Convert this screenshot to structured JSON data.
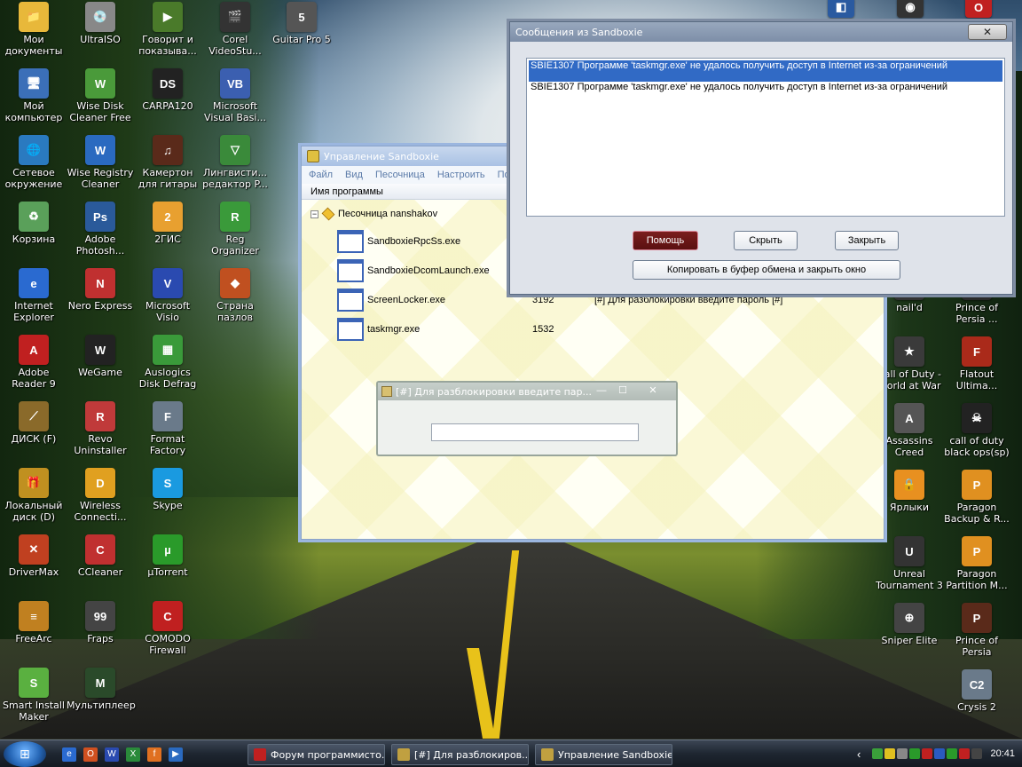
{
  "desktop": {
    "icons_left": [
      {
        "label": "Мои документы",
        "glyph": "📁",
        "color": "#e8b83a"
      },
      {
        "label": "UltraISO",
        "glyph": "💿",
        "color": "#888"
      },
      {
        "label": "Говорит и показыва...",
        "glyph": "▶",
        "color": "#4a7a2a"
      },
      {
        "label": "Corel VideoStu...",
        "glyph": "🎬",
        "color": "#333"
      },
      {
        "label": "Guitar Pro 5",
        "glyph": "5",
        "color": "#555"
      },
      {
        "label": "Мой компьютер",
        "glyph": "🖥",
        "color": "#3b6fb8"
      },
      {
        "label": "Wise Disk Cleaner Free",
        "glyph": "W",
        "color": "#4a9a3a"
      },
      {
        "label": "CARPA120",
        "glyph": "DS",
        "color": "#222"
      },
      {
        "label": "Microsoft Visual Basi...",
        "glyph": "VB",
        "color": "#3b5fb0"
      },
      {
        "label": "Сетевое окружение",
        "glyph": "🌐",
        "color": "#2a7ac0"
      },
      {
        "label": "Wise Registry Cleaner",
        "glyph": "W",
        "color": "#2a6ac0"
      },
      {
        "label": "Камертон для гитары",
        "glyph": "♫",
        "color": "#5a2a1a"
      },
      {
        "label": "Лингвисти... редактор P...",
        "glyph": "▽",
        "color": "#3a8a3a"
      },
      {
        "label": "Корзина",
        "glyph": "♻",
        "color": "#5aa05a"
      },
      {
        "label": "Adobe Photosh...",
        "glyph": "Ps",
        "color": "#2a5a9a"
      },
      {
        "label": "2ГИС",
        "glyph": "2",
        "color": "#e8a030"
      },
      {
        "label": "Reg Organizer",
        "glyph": "R",
        "color": "#3a9a3a"
      },
      {
        "label": "Internet Explorer",
        "glyph": "e",
        "color": "#2a6ad0"
      },
      {
        "label": "Nero Express",
        "glyph": "N",
        "color": "#c03030"
      },
      {
        "label": "Microsoft Visio",
        "glyph": "V",
        "color": "#2a4ab0"
      },
      {
        "label": "Страна пазлов",
        "glyph": "◆",
        "color": "#c05020"
      },
      {
        "label": "Adobe Reader 9",
        "glyph": "A",
        "color": "#c02020"
      },
      {
        "label": "WeGame",
        "glyph": "W",
        "color": "#222"
      },
      {
        "label": "Auslogics Disk Defrag",
        "glyph": "▦",
        "color": "#3a9a3a"
      },
      {
        "label": "ДИСК (F)",
        "glyph": "⟋",
        "color": "#8a6a2a"
      },
      {
        "label": "Revo Uninstaller",
        "glyph": "R",
        "color": "#c03a3a"
      },
      {
        "label": "Format Factory",
        "glyph": "F",
        "color": "#6a7a8a"
      },
      {
        "label": "Локальный диск (D)",
        "glyph": "🎁",
        "color": "#c09020"
      },
      {
        "label": "Wireless Connecti...",
        "glyph": "D",
        "color": "#e0a020"
      },
      {
        "label": "Skype",
        "glyph": "S",
        "color": "#1a9ae0"
      },
      {
        "label": "DriverMax",
        "glyph": "✕",
        "color": "#c04020"
      },
      {
        "label": "CCleaner",
        "glyph": "C",
        "color": "#c03030"
      },
      {
        "label": "µTorrent",
        "glyph": "µ",
        "color": "#2a9a2a"
      },
      {
        "label": "FreeArc",
        "glyph": "≡",
        "color": "#c08020"
      },
      {
        "label": "Fraps",
        "glyph": "99",
        "color": "#444"
      },
      {
        "label": "COMODO Firewall",
        "glyph": "C",
        "color": "#c02020"
      },
      {
        "label": "Smart Install Maker",
        "glyph": "S",
        "color": "#5ab040"
      },
      {
        "label": "Мультиплеер",
        "glyph": "M",
        "color": "#2a4a2a"
      }
    ],
    "icons_right": [
      {
        "label": "nail'd",
        "glyph": "N",
        "color": "#333"
      },
      {
        "label": "Prince of Persia ...",
        "glyph": "P",
        "color": "#2a2a2a"
      },
      {
        "label": "Call of Duty - World at War",
        "glyph": "★",
        "color": "#3a3a3a"
      },
      {
        "label": "Flatout Ultima...",
        "glyph": "F",
        "color": "#aa2a1a"
      },
      {
        "label": "Assassins Creed",
        "glyph": "A",
        "color": "#555"
      },
      {
        "label": "call of duty black ops(sp)",
        "glyph": "☠",
        "color": "#222"
      },
      {
        "label": "Ярлыки",
        "glyph": "🔒",
        "color": "#e89020"
      },
      {
        "label": "Paragon Backup & R...",
        "glyph": "P",
        "color": "#e09020"
      },
      {
        "label": "Unreal Tournament 3",
        "glyph": "U",
        "color": "#333"
      },
      {
        "label": "Paragon Partition M...",
        "glyph": "P",
        "color": "#e09020"
      },
      {
        "label": "Sniper Elite",
        "glyph": "⊕",
        "color": "#444"
      },
      {
        "label": "Prince of Persia",
        "glyph": "P",
        "color": "#5a2a1a"
      },
      {
        "label": "Crysis 2",
        "glyph": "C2",
        "color": "#6a7a8a"
      }
    ],
    "top_right_icons": [
      {
        "name": "virtualbox-icon",
        "glyph": "◧",
        "color": "#2a5aa0"
      },
      {
        "name": "steam-icon",
        "glyph": "◉",
        "color": "#333"
      },
      {
        "name": "opera-icon",
        "glyph": "O",
        "color": "#c02020"
      }
    ]
  },
  "sandboxie": {
    "title": "Управление Sandboxie",
    "menu": [
      "Файл",
      "Вид",
      "Песочница",
      "Настроить",
      "По"
    ],
    "column_header": "Имя программы",
    "sandbox_name": "Песочница nanshakov",
    "tree_toggle": "−",
    "processes": [
      {
        "name": "SandboxieRpcSs.exe",
        "pid": "",
        "title": ""
      },
      {
        "name": "SandboxieDcomLaunch.exe",
        "pid": "",
        "title": ""
      },
      {
        "name": "ScreenLocker.exe",
        "pid": "3192",
        "title": "[#] Для разблокировки введите пароль [#]"
      },
      {
        "name": "taskmgr.exe",
        "pid": "1532",
        "title": ""
      }
    ]
  },
  "lock_dialog": {
    "title": "[#] Для разблокировки введите пар...",
    "password_value": "",
    "minimize": "—",
    "maximize": "☐",
    "close": "✕"
  },
  "messages_dialog": {
    "title": "Сообщения из Sandboxie",
    "close": "✕",
    "messages": [
      {
        "text": "SBIE1307 Программе 'taskmgr.exe' не удалось получить доступ в Internet из-за ограничений",
        "selected": true
      },
      {
        "text": "SBIE1307 Программе 'taskmgr.exe' не удалось получить доступ в Internet из-за ограничений",
        "selected": false
      }
    ],
    "buttons": {
      "help": "Помощь",
      "hide": "Скрыть",
      "close": "Закрыть",
      "copy_close": "Копировать в буфер обмена и закрыть окно"
    }
  },
  "taskbar": {
    "start_glyph": "⊞",
    "quick_launch": [
      {
        "name": "network-icon",
        "glyph": "e",
        "color": "#2a6ad0"
      },
      {
        "name": "office-icon",
        "glyph": "O",
        "color": "#d05020"
      },
      {
        "name": "word-icon",
        "glyph": "W",
        "color": "#2a4ab0"
      },
      {
        "name": "excel-icon",
        "glyph": "X",
        "color": "#2a8a3a"
      },
      {
        "name": "firefox-icon",
        "glyph": "f",
        "color": "#e07020"
      },
      {
        "name": "media-icon",
        "glyph": "▶",
        "color": "#2a6ac0"
      }
    ],
    "tasks": [
      {
        "label": "Форум программисто...",
        "color": "#c02020"
      },
      {
        "label": "[#] Для разблокиров...",
        "color": "#c0a040"
      },
      {
        "label": "Управление Sandboxie",
        "color": "#c0a040"
      }
    ],
    "tray_chevron": "‹",
    "tray_icons": [
      "#3aa03a",
      "#e0c020",
      "#888",
      "#2a9a2a",
      "#c02020",
      "#2a5ac0",
      "#2a9a2a",
      "#c02020",
      "#444"
    ],
    "clock": "20:41"
  }
}
